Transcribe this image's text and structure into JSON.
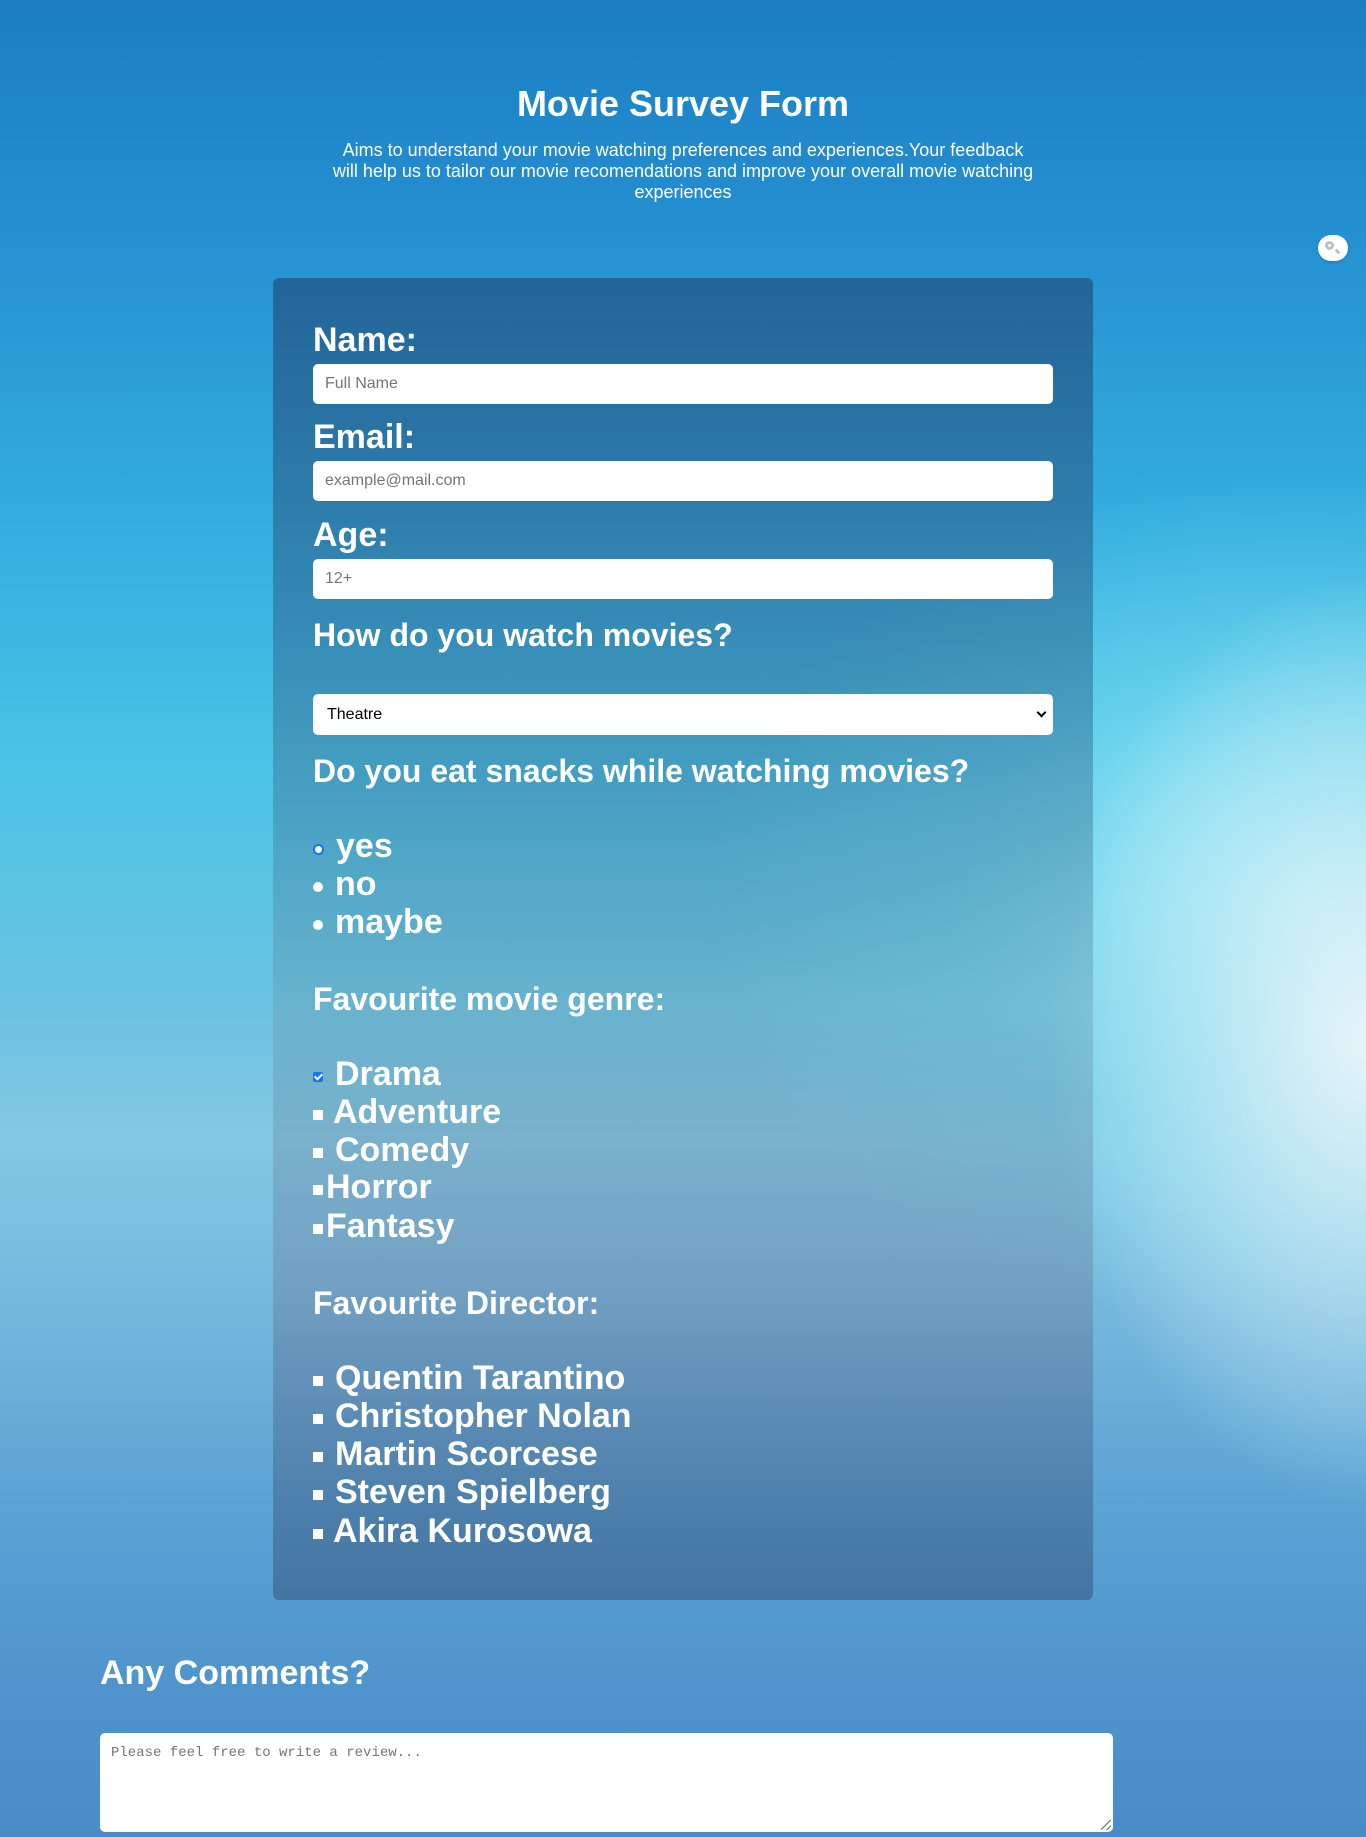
{
  "header": {
    "title": "Movie Survey Form",
    "description": "Aims to understand your movie watching preferences and experiences.Your feedback will help us to tailor our movie recomendations and improve your overall movie watching experiences"
  },
  "form": {
    "name": {
      "label": "Name:",
      "placeholder": "Full Name"
    },
    "email": {
      "label": "Email:",
      "placeholder": "example@mail.com"
    },
    "age": {
      "label": "Age:",
      "placeholder": "12+"
    },
    "watch": {
      "question": "How do you watch movies?",
      "selected": "Theatre"
    },
    "snacks": {
      "question": "Do you eat snacks while watching movies?",
      "options": [
        {
          "label": "yes",
          "selected": true
        },
        {
          "label": "no",
          "selected": false
        },
        {
          "label": "maybe",
          "selected": false
        }
      ]
    },
    "genre": {
      "question": "Favourite movie genre:",
      "options": [
        {
          "label": "Drama",
          "checked": true
        },
        {
          "label": "Adventure",
          "checked": false
        },
        {
          "label": "Comedy",
          "checked": false
        },
        {
          "label": "Horror",
          "checked": false
        },
        {
          "label": "Fantasy",
          "checked": false
        }
      ]
    },
    "director": {
      "question": "Favourite Director:",
      "options": [
        {
          "label": "Quentin Tarantino",
          "checked": false
        },
        {
          "label": "Christopher Nolan",
          "checked": false
        },
        {
          "label": "Martin Scorcese",
          "checked": false
        },
        {
          "label": "Steven Spielberg",
          "checked": false
        },
        {
          "label": "Akira Kurosowa",
          "checked": false
        }
      ]
    }
  },
  "comments": {
    "title": "Any Comments?",
    "placeholder": "Please feel free to write a review..."
  },
  "icons": {
    "corner_widget": "search-icon"
  },
  "colors": {
    "accent": "#1a73e8",
    "text": "#ffffff"
  }
}
